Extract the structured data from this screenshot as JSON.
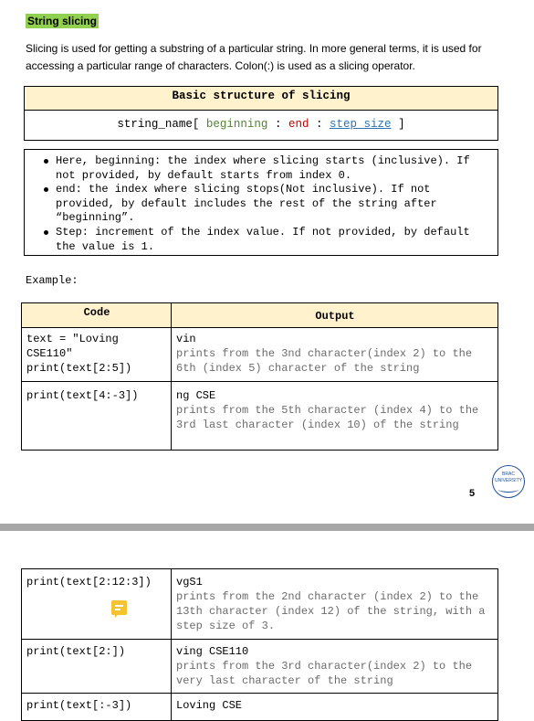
{
  "page1": {
    "title": "String slicing",
    "intro": "Slicing is used for getting a substring of a particular string. In more general terms, it is used for accessing a particular range of characters. Colon(:) is used as a slicing operator.",
    "structure_heading": "Basic structure of slicing",
    "syntax": {
      "name": "string_name[",
      "beginning": "beginning",
      "sep1": ":",
      "end": "end",
      "sep2": ":",
      "step": "step_size",
      "close": "]"
    },
    "bullets": [
      "Here, beginning: the index where slicing starts (inclusive). If not provided, by default starts from index 0.",
      "end: the index where slicing stops(Not inclusive). If not provided, by default includes the rest of the string after “beginning”.",
      "Step: increment of the index value. If not provided, by default the value is 1."
    ],
    "example_label": "Example:",
    "table": {
      "code_header": "Code",
      "output_header": "Output",
      "rows": [
        {
          "code": "text = \"Loving CSE110\"\nprint(text[2:5])",
          "output": "vin",
          "note": "prints from the 3nd character(index 2) to the 6th (index 5) character of the string"
        },
        {
          "code": "print(text[4:-3])",
          "output": "ng CSE",
          "note": "prints from the 5th character (index 4) to the 3rd last character (index 10) of the string"
        }
      ]
    },
    "page_number": "5",
    "logo_text": "BRAC UNIVERSITY"
  },
  "page2": {
    "rows": [
      {
        "code": "print(text[2:12:3])",
        "output": "vgS1",
        "note": "prints from the 2nd character (index 2) to the 13th character (index 12) of the string, with a step size of 3."
      },
      {
        "code": "print(text[2:])",
        "output": "ving CSE110",
        "note": "prints from the 3rd character(index 2) to the very last character of the string"
      },
      {
        "code": "print(text[:-3])",
        "output": "Loving CSE",
        "note": ""
      }
    ]
  },
  "colors": {
    "title_highlight": "#92d050",
    "header_fill": "#fff2cc",
    "separator": "#a6a6a6",
    "comment_icon": "#f4c430"
  }
}
